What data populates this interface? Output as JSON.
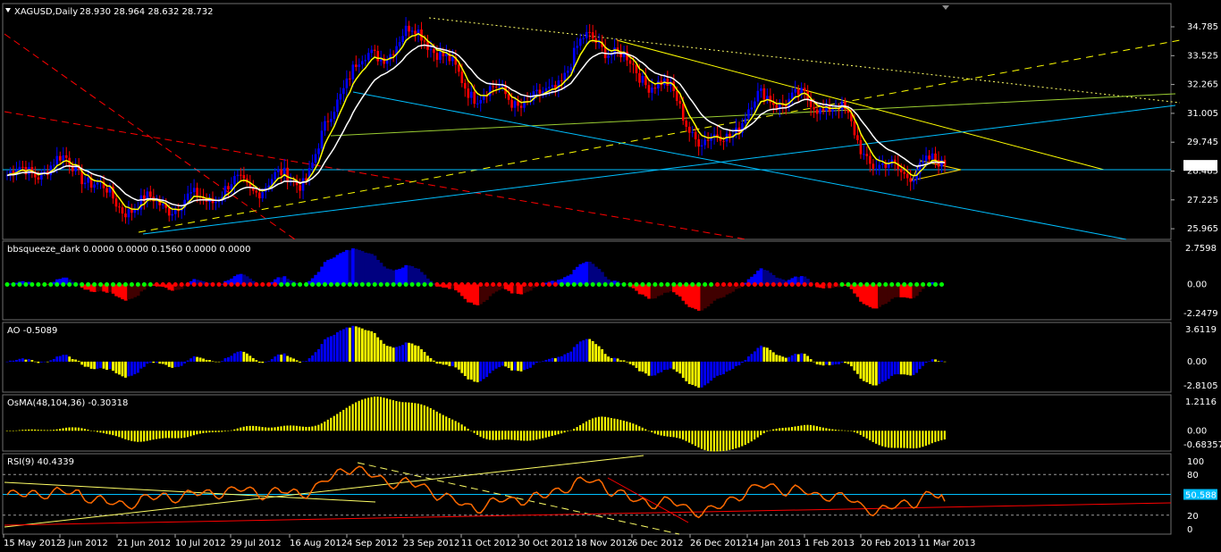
{
  "symbol_label": "XAGUSD,Daily",
  "ohlc_label": "28.930 28.964 28.632 28.732",
  "colors": {
    "background": "#000000",
    "bull": "#0000ff",
    "bear": "#ff0000",
    "ma_fast": "#ffff00",
    "ma_slow": "#ffffff",
    "squeeze_on": "#00ff00",
    "squeeze_off": "#ff0000",
    "rsi": "#ff6a00",
    "level_line": "#00bfff"
  },
  "chart_data": [
    {
      "type": "candlestick",
      "title": "XAGUSD,Daily",
      "y_ticks": [
        "34.785",
        "33.525",
        "32.265",
        "31.005",
        "29.745",
        "28.485",
        "27.225",
        "25.965"
      ],
      "ylim": [
        25.5,
        35.8
      ],
      "current_price": "28.732",
      "ohlc": {
        "open": 28.93,
        "high": 28.964,
        "low": 28.632,
        "close": 28.732
      },
      "close_path": [
        [
          "15 May 2012",
          28.3
        ],
        [
          "3 Jun 2012",
          28.8
        ],
        [
          "21 Jun 2012",
          27.0
        ],
        [
          "10 Jul 2012",
          27.1
        ],
        [
          "29 Jul 2012",
          27.8
        ],
        [
          "16 Aug 2012",
          28.2
        ],
        [
          "4 Sep 2012",
          33.2
        ],
        [
          "23 Sep 2012",
          34.5
        ],
        [
          "11 Oct 2012",
          32.0
        ],
        [
          "30 Oct 2012",
          31.5
        ],
        [
          "18 Nov 2012",
          34.2
        ],
        [
          "6 Dec 2012",
          32.5
        ],
        [
          "26 Dec 2012",
          29.7
        ],
        [
          "14 Jan 2013",
          31.7
        ],
        [
          "1 Feb 2013",
          31.4
        ],
        [
          "20 Feb 2013",
          28.5
        ],
        [
          "11 Mar 2013",
          28.73
        ]
      ],
      "overlays": [
        "fast moving average",
        "slow moving average",
        "trend lines"
      ]
    },
    {
      "type": "histogram",
      "title": "bbsqueeze_dark 0.0000 0.0000 0.1560 0.0000 0.0000",
      "y_ticks": [
        "2.7598",
        "0.00",
        "-2.2479"
      ],
      "ylim": [
        -2.2479,
        2.7598
      ]
    },
    {
      "type": "histogram",
      "title": "AO -0.5089",
      "y_ticks": [
        "3.6119",
        "0.00",
        "-2.8105"
      ],
      "ylim": [
        -2.8105,
        3.6119
      ],
      "last_value": -0.5089
    },
    {
      "type": "histogram",
      "title": "OsMA(48,104,36) -0.30318",
      "y_ticks": [
        "1.2116",
        "0.00",
        "-0.68357"
      ],
      "ylim": [
        -0.68357,
        1.2116
      ],
      "last_value": -0.30318
    },
    {
      "type": "line",
      "title": "RSI(9) 40.4339",
      "y_ticks": [
        "100",
        "80",
        "20",
        "0"
      ],
      "levels": [
        80,
        50.588,
        20
      ],
      "level_label": "50.588",
      "ylim": [
        0,
        100
      ],
      "last_value": 40.4339
    }
  ],
  "x_ticks": [
    "15 May 2012",
    "3 Jun 2012",
    "21 Jun 2012",
    "10 Jul 2012",
    "29 Jul 2012",
    "16 Aug 2012",
    "4 Sep 2012",
    "23 Sep 2012",
    "11 Oct 2012",
    "30 Oct 2012",
    "18 Nov 2012",
    "6 Dec 2012",
    "26 Dec 2012",
    "14 Jan 2013",
    "1 Feb 2013",
    "20 Feb 2013",
    "11 Mar 2013"
  ]
}
